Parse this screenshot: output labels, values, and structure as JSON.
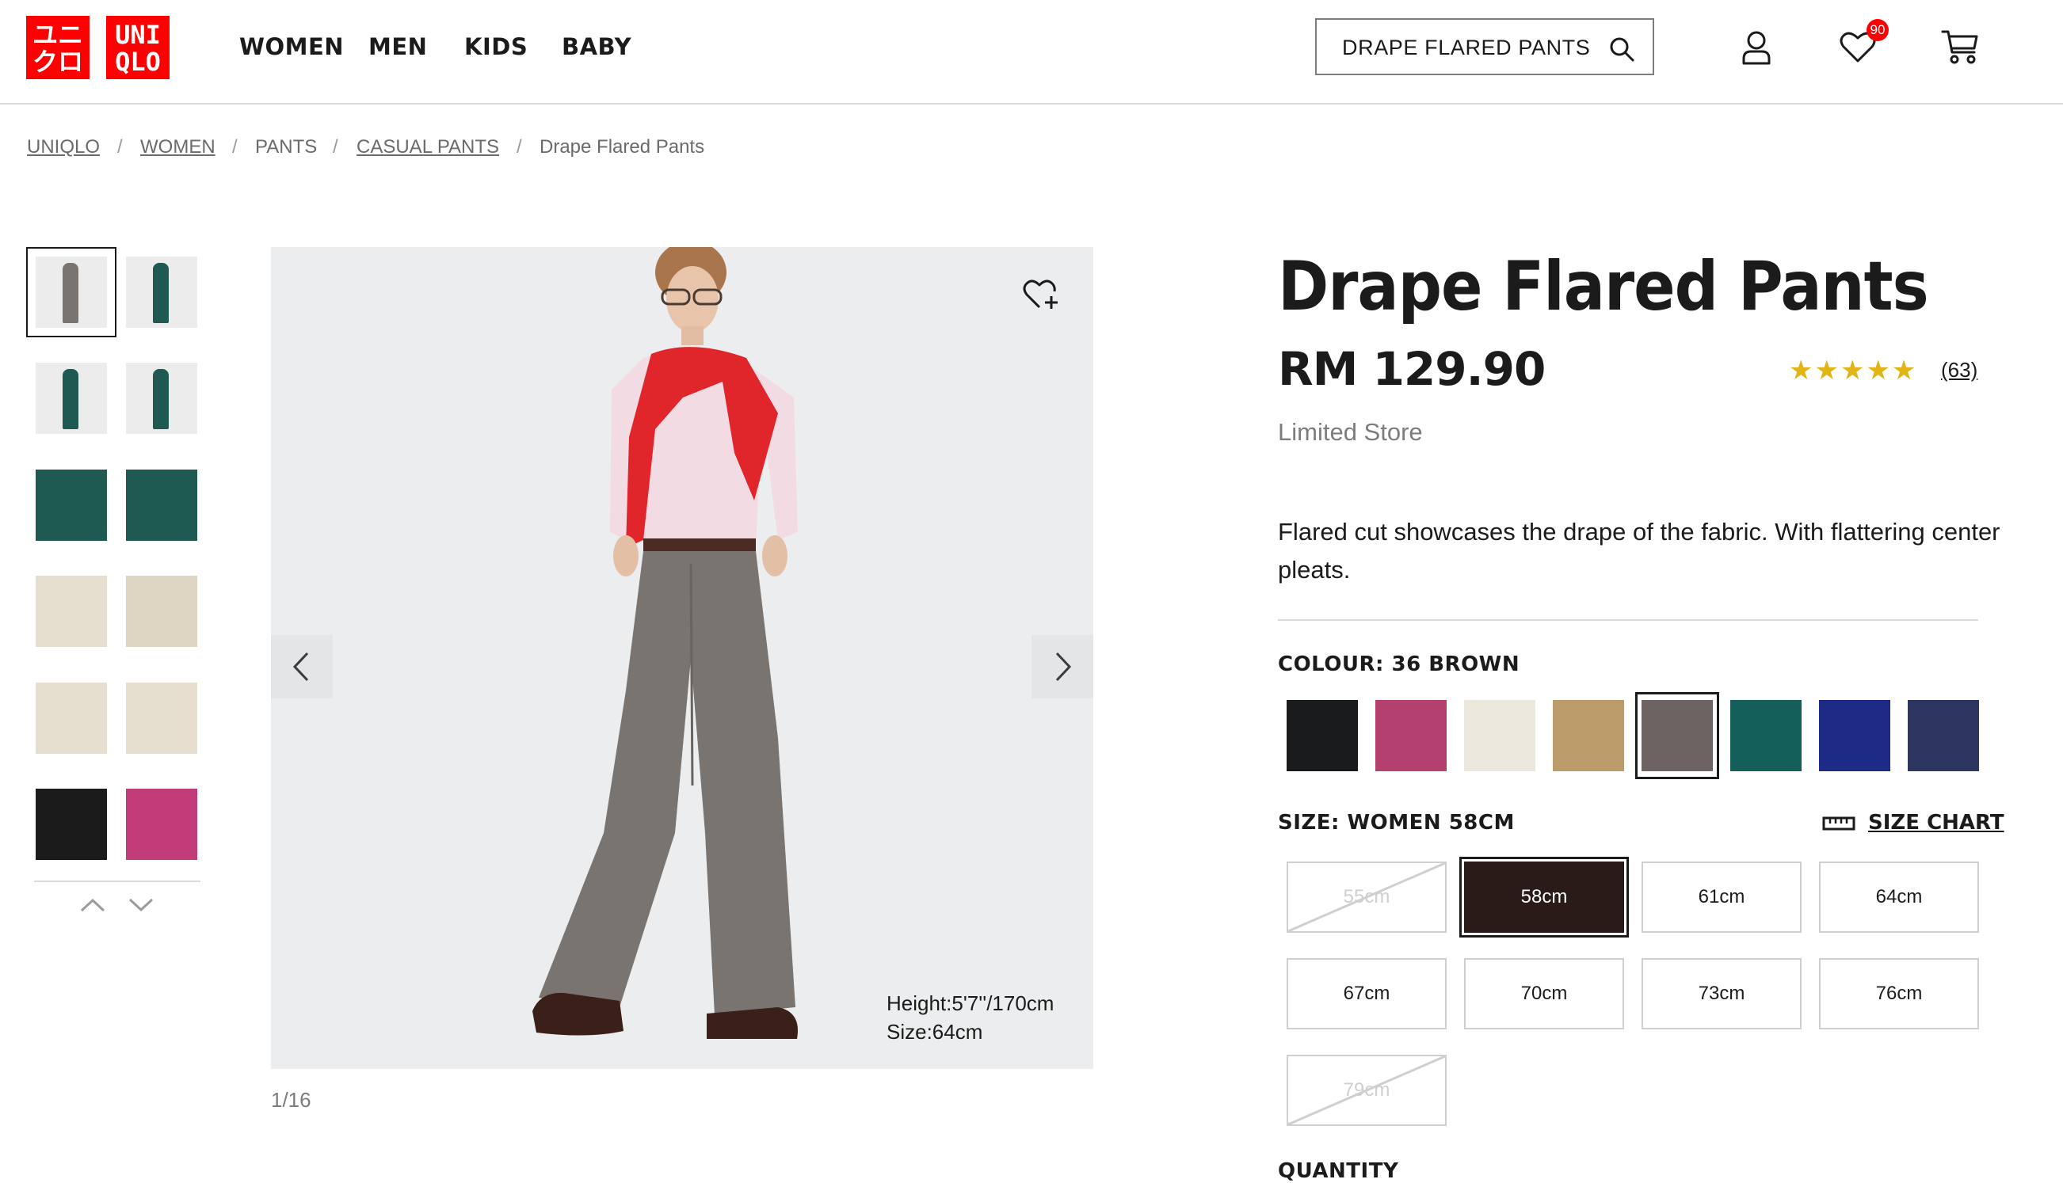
{
  "brand": {
    "logo_line1": "ユニ",
    "logo_line2": "クロ",
    "logo_en1": "UNI",
    "logo_en2": "QLO"
  },
  "nav": [
    "WOMEN",
    "MEN",
    "KIDS",
    "BABY"
  ],
  "search": {
    "value": "DRAPE FLARED PANTS",
    "icon": "search-icon"
  },
  "header_icons": {
    "account": "user-icon",
    "wishlist": "heart-icon",
    "wishlist_count": "90",
    "cart": "cart-icon"
  },
  "breadcrumb": [
    "UNIQLO",
    "WOMEN",
    "PANTS",
    "CASUAL PANTS",
    "Drape Flared Pants"
  ],
  "gallery": {
    "counter": "1/16",
    "caption_height": "Height:5'7''/170cm",
    "caption_size": "Size:64cm",
    "thumb_colors": [
      "#e9e9e9",
      "#e9e9e9",
      "#e9e9e9",
      "#e9e9e9",
      "#1e5a52",
      "#1e5a52",
      "#e6dfcf",
      "#ddd4c2",
      "#e6dfcf",
      "#e6dfcf",
      "#1b1b1b",
      "#c13c79"
    ]
  },
  "product": {
    "title": "Drape Flared Pants",
    "price": "RM 129.90",
    "rating_stars": "★★★★★",
    "rating_value": 4.5,
    "review_count": "(63)",
    "availability": "Limited Store",
    "description": "Flared cut showcases the drape of the fabric. With flattering center pleats."
  },
  "colour": {
    "label": "COLOUR: 36 BROWN",
    "swatches": [
      "#1a1b1d",
      "#b3406f",
      "#ece7dd",
      "#bc9b6b",
      "#6d6363",
      "#155f5b",
      "#1d2b87",
      "#2c3660"
    ],
    "selected_index": 4
  },
  "size": {
    "label": "SIZE: WOMEN 58CM",
    "chart_label": "SIZE CHART",
    "options": [
      {
        "label": "55cm",
        "available": false
      },
      {
        "label": "58cm",
        "available": true,
        "selected": true
      },
      {
        "label": "61cm",
        "available": true
      },
      {
        "label": "64cm",
        "available": true
      },
      {
        "label": "67cm",
        "available": true
      },
      {
        "label": "70cm",
        "available": true
      },
      {
        "label": "73cm",
        "available": true
      },
      {
        "label": "76cm",
        "available": true
      },
      {
        "label": "79cm",
        "available": false
      }
    ]
  },
  "quantity": {
    "label": "QUANTITY"
  }
}
